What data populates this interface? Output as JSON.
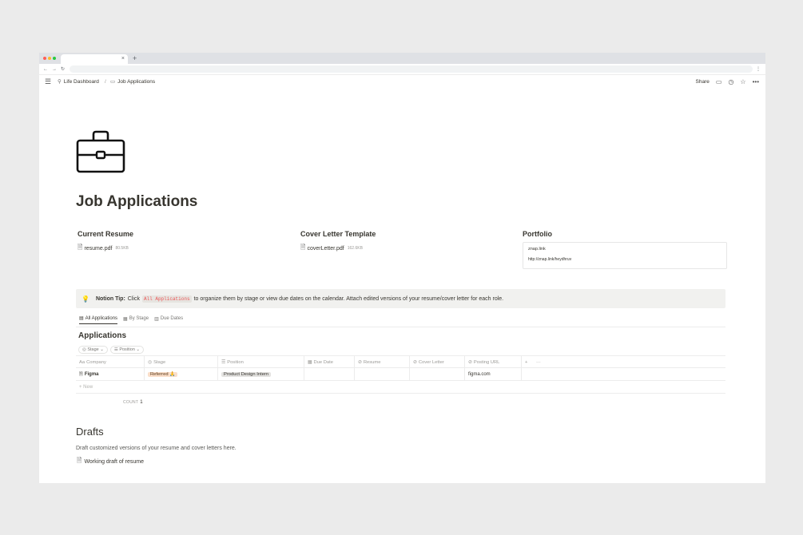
{
  "browser": {
    "tab_close": "×",
    "new_tab": "+",
    "nav_back": "←",
    "nav_forward": "→",
    "nav_reload": "↻",
    "menu": "⋮"
  },
  "topbar": {
    "breadcrumb": [
      "Life Dashboard",
      "/",
      "Job Applications"
    ],
    "share_label": "Share",
    "comment_icon": "comment-icon",
    "clock_icon": "clock-icon",
    "star_icon": "star-icon",
    "more_label": "•••"
  },
  "page": {
    "icon": "briefcase-icon",
    "title": "Job Applications"
  },
  "properties": {
    "resume": {
      "heading": "Current Resume",
      "file_name": "resume.pdf",
      "file_size": "80.5KB"
    },
    "cover_letter": {
      "heading": "Cover Letter Template",
      "file_name": "coverLetter.pdf",
      "file_size": "162.6KB"
    },
    "portfolio": {
      "heading": "Portfolio",
      "link_title": "znap.link",
      "link_url": "http://znap.link/heydhruv"
    }
  },
  "tip": {
    "label": "Notion Tip:",
    "text_before": "Click",
    "code": "All Applications",
    "text_after": "to organize them by stage or view due dates on the calendar. Attach edited versions of your resume/cover letter for each role."
  },
  "views": {
    "tabs": [
      {
        "icon": "▤",
        "label": "All Applications"
      },
      {
        "icon": "▦",
        "label": "By Stage"
      },
      {
        "icon": "▥",
        "label": "Due Dates"
      }
    ]
  },
  "database": {
    "title": "Applications",
    "filters": [
      "Stage ⌄",
      "Position ⌄"
    ],
    "columns": [
      "Company",
      "Stage",
      "Position",
      "Due Date",
      "Resume",
      "Cover Letter",
      "Posting URL"
    ],
    "column_icons": [
      "Aa",
      "◎",
      "☰",
      "▦",
      "⊘",
      "⊘",
      "⊘"
    ],
    "add_column": "+",
    "more_columns": "···",
    "rows": [
      {
        "company": "Figma",
        "stage": "Referred 🙏",
        "position": "Product Design Intern",
        "due_date": "",
        "resume": "",
        "cover_letter": "",
        "posting_url": "figma.com"
      }
    ],
    "new_label": "+ New",
    "count_label": "COUNT",
    "count_value": "1"
  },
  "drafts": {
    "heading": "Drafts",
    "description": "Draft customized versions of your resume and cover letters here.",
    "link": "Working draft of resume"
  }
}
